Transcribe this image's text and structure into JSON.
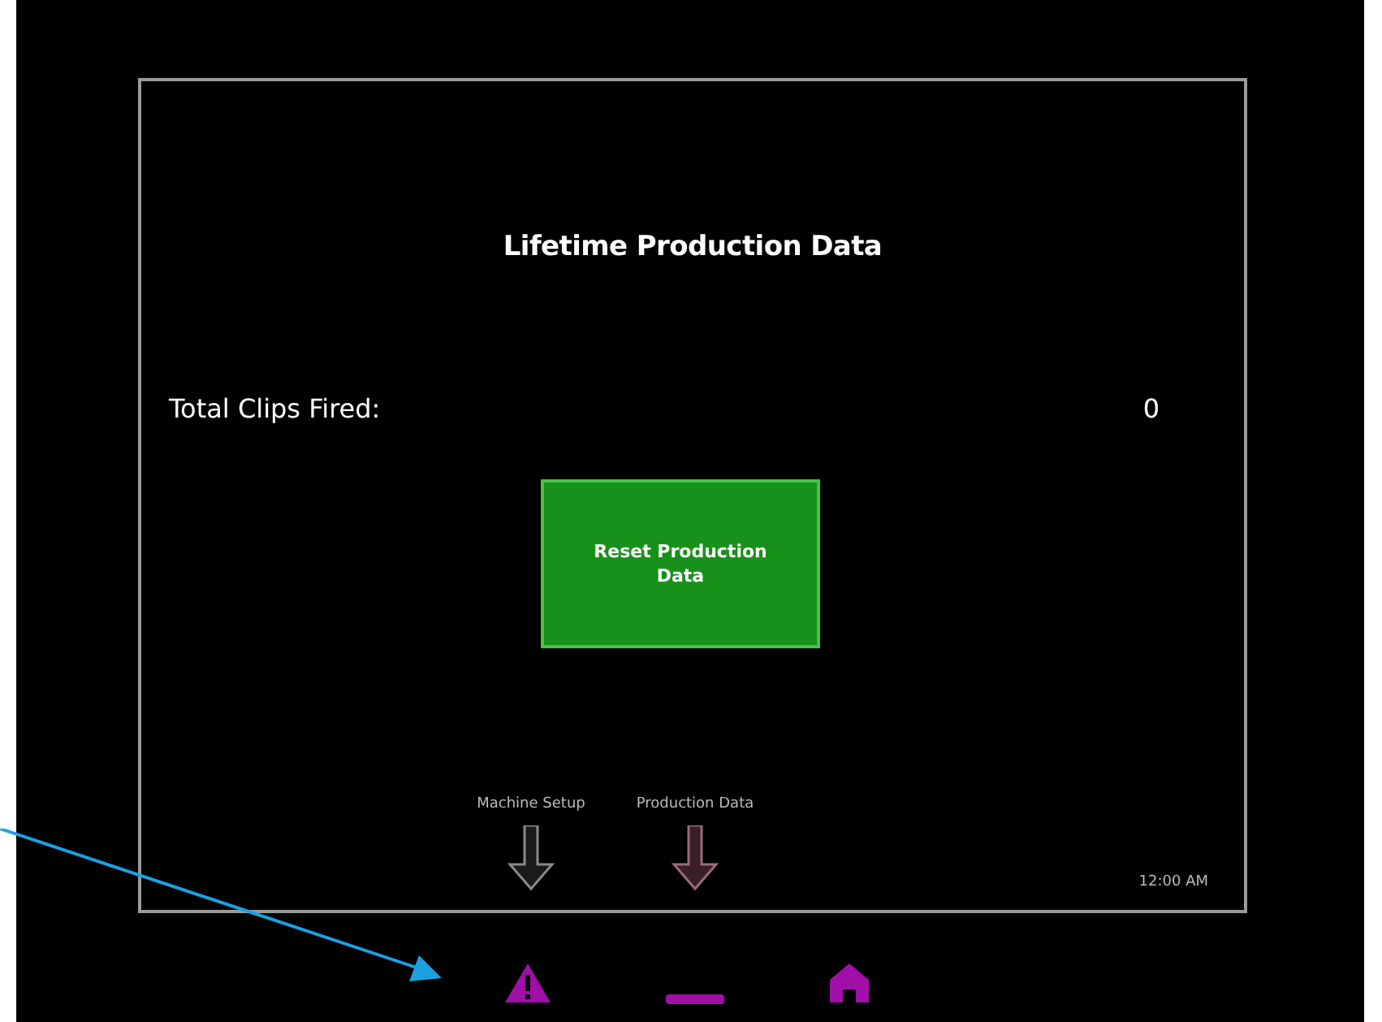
{
  "screen": {
    "title": "Lifetime Production Data",
    "rows": [
      {
        "label": "Total Clips Fired:",
        "value": "0"
      }
    ],
    "button": {
      "label": "Reset Production Data"
    }
  },
  "nav": [
    {
      "label": "Machine Setup",
      "selected": false
    },
    {
      "label": "Production Data",
      "selected": true
    }
  ],
  "time": "12:00 AM",
  "footer_icons": [
    {
      "kind": "warning"
    },
    {
      "kind": "dash"
    },
    {
      "kind": "home"
    }
  ]
}
